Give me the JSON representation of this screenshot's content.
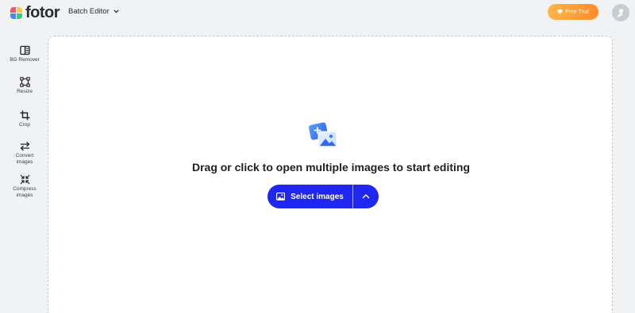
{
  "app": {
    "logo_text": "fotor",
    "editor_switch_label": "Batch Editor",
    "free_trial_label": "Free Trial"
  },
  "sidebar": {
    "items": [
      {
        "label": "BG Remover",
        "icon": "bg-remover-icon"
      },
      {
        "label": "Resize",
        "icon": "resize-icon"
      },
      {
        "label": "Crop",
        "icon": "crop-icon"
      },
      {
        "label": "Convert images",
        "icon": "convert-icon"
      },
      {
        "label": "Compress images",
        "icon": "compress-icon"
      }
    ]
  },
  "upload": {
    "prompt": "Drag or click to open multiple images to start editing",
    "button_label": "Select images"
  },
  "colors": {
    "accent": "#1f26f0",
    "trial_gradient_start": "#ffb547",
    "trial_gradient_end": "#ff8a2a",
    "background": "#f1f2f4"
  }
}
